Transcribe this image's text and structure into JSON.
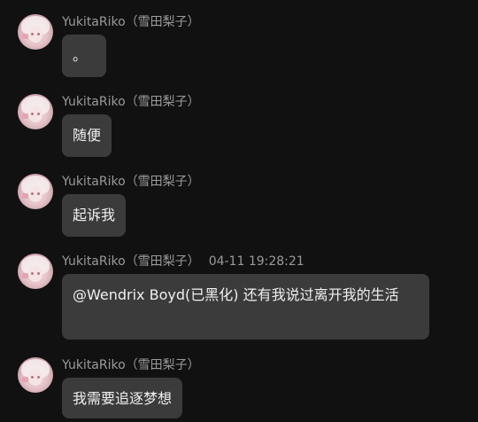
{
  "messages": [
    {
      "sender": "YukitaRiko（雪田梨子）",
      "time": "",
      "text": "。"
    },
    {
      "sender": "YukitaRiko（雪田梨子）",
      "time": "",
      "text": "随便"
    },
    {
      "sender": "YukitaRiko（雪田梨子）",
      "time": "",
      "text": "起诉我"
    },
    {
      "sender": "YukitaRiko（雪田梨子）",
      "time": "04-11 19:28:21",
      "text": "@Wendrix Boyd(已黑化) 还有我说过离开我的生活"
    },
    {
      "sender": "YukitaRiko（雪田梨子）",
      "time": "",
      "text": "我需要追逐梦想"
    }
  ],
  "colors": {
    "background": "#111111",
    "bubble": "#3b3b3b",
    "text": "#f0f0f0",
    "meta": "#9a9a9a"
  }
}
